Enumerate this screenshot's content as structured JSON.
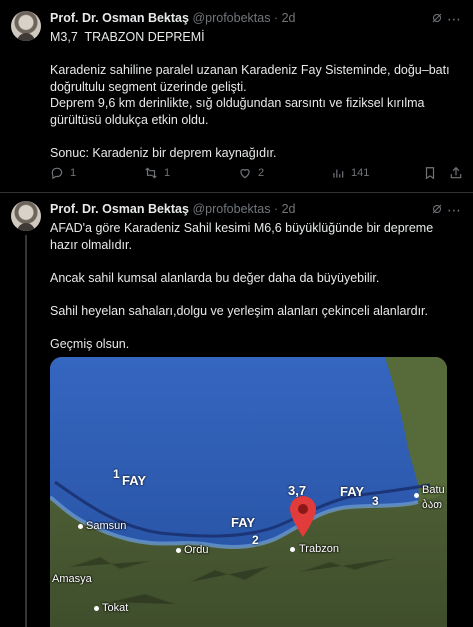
{
  "tweets": [
    {
      "name": "Prof. Dr. Osman Bektaş",
      "handle": "@profobektas",
      "separator": "·",
      "time": "2d",
      "text": "M3,7  TRABZON DEPREMİ\n\nKaradeniz sahiline paralel uzanan Karadeniz Fay Sisteminde, doğu–batı doğrultulu segment üzerinde gelişti.\nDeprem 9,6 km derinlikte, sığ olduğundan sarsıntı ve fiziksel kırılma gürültüsü oldukça etkin oldu.\n\nSonuc: Karadeniz bir deprem kaynağıdır.",
      "actions": {
        "replies": "1",
        "reposts": "1",
        "likes": "2",
        "views": "141"
      }
    },
    {
      "name": "Prof. Dr. Osman Bektaş",
      "handle": "@profobektas",
      "separator": "·",
      "time": "2d",
      "text": "AFAD'a göre Karadeniz Sahil kesimi M6,6 büyüklüğünde bir depreme hazır olmalıdır.\n\nAncak sahil kumsal alanlarda bu değer daha da büyüyebilir.\n\nSahil heyelan sahaları,dolgu ve yerleşim alanları çekinceli alanlardır.\n\nGeçmiş olsun."
    }
  ],
  "map": {
    "fault_label": "FAY",
    "segment_numbers": [
      "1",
      "2",
      "3"
    ],
    "magnitude_label": "3,7",
    "cities": [
      "Samsun",
      "Ordu",
      "Trabzon",
      "Amasya",
      "Tokat",
      "Batu",
      "ბათ"
    ],
    "colors": {
      "sea": "#2f63b8",
      "land": "#4a5c34",
      "fault": "#1a2f6e",
      "pin": "#e23b3b"
    }
  },
  "icons": [
    "more-icon",
    "grok-icon",
    "reply-icon",
    "repost-icon",
    "like-icon",
    "views-icon",
    "bookmark-icon",
    "share-icon"
  ]
}
